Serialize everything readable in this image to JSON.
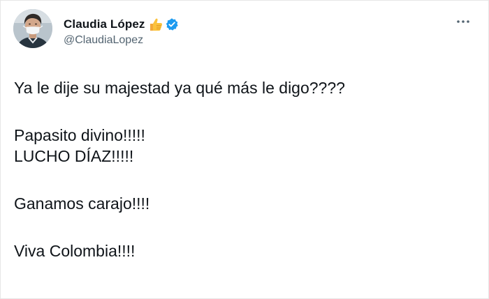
{
  "tweet": {
    "author": {
      "display_name": "Claudia López",
      "handle": "@ClaudiaLopez",
      "avatar_icon": "avatar-photo",
      "emoji_icon": "thumbs-up-icon",
      "verified_icon": "verified-badge-icon",
      "verified_color": "#1d9bf0"
    },
    "more_icon": "more-options-icon",
    "lines": {
      "l1": "Ya le dije su majestad ya qué más le digo????",
      "l2": "Papasito divino!!!!!",
      "l3": "LUCHO DÍAZ!!!!!",
      "l4": "Ganamos carajo!!!!",
      "l5": "Viva Colombia!!!!"
    }
  }
}
